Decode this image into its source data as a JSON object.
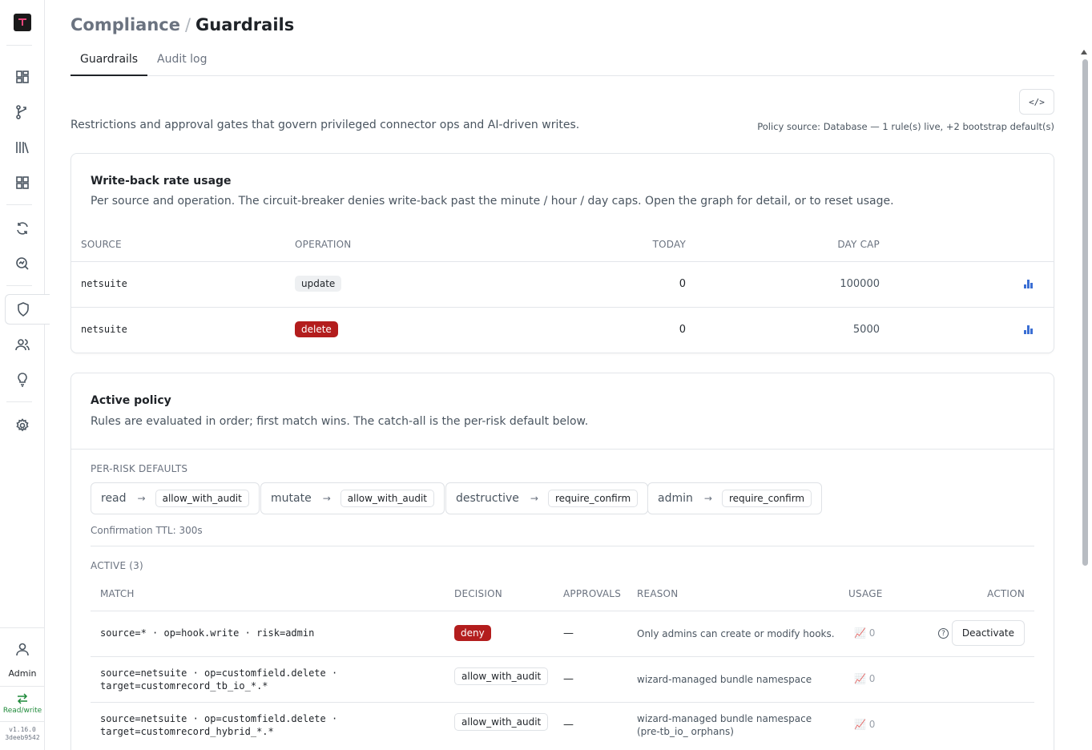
{
  "sidebar": {
    "items": [
      {
        "name": "dashboard-icon"
      },
      {
        "name": "branch-icon"
      },
      {
        "name": "library-icon"
      },
      {
        "name": "grid-icon"
      },
      {
        "name": "sync-icon"
      },
      {
        "name": "search-analytics-icon"
      },
      {
        "name": "shield-icon",
        "active": true
      },
      {
        "name": "users-icon"
      },
      {
        "name": "lightbulb-icon"
      },
      {
        "name": "gear-icon"
      }
    ],
    "user_label": "Admin",
    "mode_label": "Read/write",
    "version": "v1.16.0",
    "build": "3deeb9542"
  },
  "header": {
    "breadcrumb_parent": "Compliance",
    "breadcrumb_sep": "/",
    "breadcrumb_current": "Guardrails",
    "tabs": [
      {
        "label": "Guardrails",
        "active": true
      },
      {
        "label": "Audit log",
        "active": false
      }
    ],
    "code_button": "</>",
    "intro": "Restrictions and approval gates that govern privileged connector ops and AI-driven writes.",
    "policy_source": "Policy source: Database — 1 rule(s) live, +2 bootstrap default(s)"
  },
  "rate_usage": {
    "title": "Write-back rate usage",
    "subtitle": "Per source and operation. The circuit-breaker denies write-back past the minute / hour / day caps. Open the graph for detail, or to reset usage.",
    "columns": {
      "source": "SOURCE",
      "operation": "OPERATION",
      "today": "TODAY",
      "day_cap": "DAY CAP"
    },
    "rows": [
      {
        "source": "netsuite",
        "operation": "update",
        "op_style": "grey",
        "today": "0",
        "day_cap": "100000"
      },
      {
        "source": "netsuite",
        "operation": "delete",
        "op_style": "red",
        "today": "0",
        "day_cap": "5000"
      }
    ]
  },
  "active_policy": {
    "title": "Active policy",
    "subtitle": "Rules are evaluated in order; first match wins. The catch-all is the per-risk default below.",
    "defaults_label": "PER-RISK DEFAULTS",
    "arrow": "→",
    "defaults": [
      {
        "risk": "read",
        "decision": "allow_with_audit"
      },
      {
        "risk": "mutate",
        "decision": "allow_with_audit"
      },
      {
        "risk": "destructive",
        "decision": "require_confirm"
      },
      {
        "risk": "admin",
        "decision": "require_confirm"
      }
    ],
    "ttl": "Confirmation TTL: 300s",
    "active_label": "ACTIVE (3)",
    "columns": {
      "match": "MATCH",
      "decision": "DECISION",
      "approvals": "APPROVALS",
      "reason": "REASON",
      "usage": "USAGE",
      "action": "ACTION"
    },
    "rules": [
      {
        "match_line1": "source=* · op=hook.write · risk=admin",
        "match_line2": "",
        "decision": "deny",
        "decision_style": "red",
        "approvals": "—",
        "reason": "Only admins can create or modify hooks.",
        "usage": "📈 0",
        "action": "Deactivate"
      },
      {
        "match_line1": "source=netsuite · op=customfield.delete ·",
        "match_line2": "target=customrecord_tb_io_*.*",
        "decision": "allow_with_audit",
        "decision_style": "outline",
        "approvals": "—",
        "reason": "wizard-managed bundle namespace",
        "usage": "📈 0",
        "action": ""
      },
      {
        "match_line1": "source=netsuite · op=customfield.delete ·",
        "match_line2": "target=customrecord_hybrid_*.*",
        "decision": "allow_with_audit",
        "decision_style": "outline",
        "approvals": "—",
        "reason": "wizard-managed bundle namespace (pre-tb_io_ orphans)",
        "usage": "📈 0",
        "action": ""
      }
    ]
  }
}
